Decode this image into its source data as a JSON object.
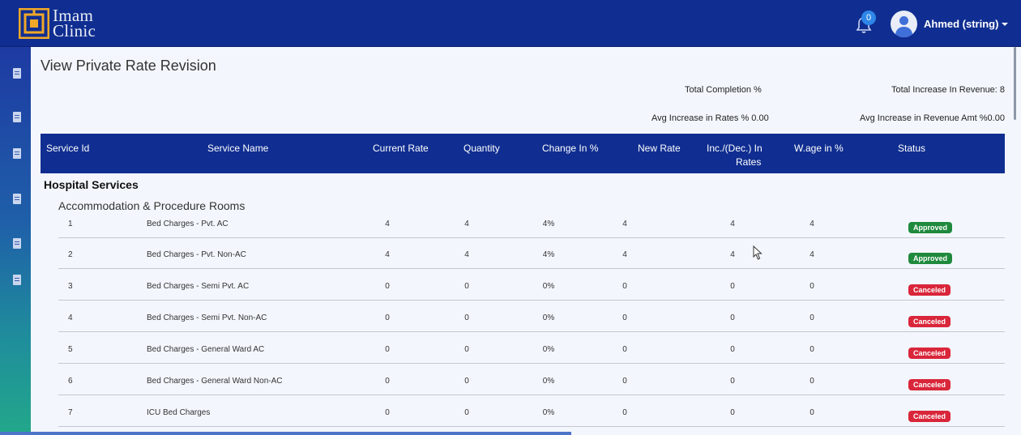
{
  "app": {
    "brand_line1": "Imam",
    "brand_line2": "Clinic"
  },
  "header": {
    "notification_count": "0",
    "user_name": "Ahmed (string)"
  },
  "page": {
    "title": "View Private Rate Revision",
    "total_completion_label": "Total Completion %",
    "total_increase_revenue_label": "Total Increase In Revenue: 8",
    "avg_increase_rates_label": "Avg Increase in Rates % 0.00",
    "avg_increase_revenue_label": "Avg Increase in Revenue Amt %0.00"
  },
  "table": {
    "headers": [
      "Service Id",
      "Service Name",
      "Current Rate",
      "Quantity",
      "Change In %",
      "New Rate",
      "Inc./(Dec.) In",
      "Rates",
      "W.age in %",
      "Status"
    ],
    "section": "Hospital Services",
    "subsection": "Accommodation & Procedure Rooms",
    "rows": [
      {
        "id": "1",
        "name": "Bed Charges - Pvt. AC",
        "current_rate": "4",
        "quantity": "4",
        "change": "4%",
        "new_rate": "4",
        "inc_dec": "4",
        "wage": "4",
        "status": "Approved"
      },
      {
        "id": "2",
        "name": "Bed Charges - Pvt. Non-AC",
        "current_rate": "4",
        "quantity": "4",
        "change": "4%",
        "new_rate": "4",
        "inc_dec": "4",
        "wage": "4",
        "status": "Approved"
      },
      {
        "id": "3",
        "name": "Bed Charges - Semi Pvt. AC",
        "current_rate": "0",
        "quantity": "0",
        "change": "0%",
        "new_rate": "0",
        "inc_dec": "0",
        "wage": "0",
        "status": "Canceled"
      },
      {
        "id": "4",
        "name": "Bed Charges - Semi Pvt. Non-AC",
        "current_rate": "0",
        "quantity": "0",
        "change": "0%",
        "new_rate": "0",
        "inc_dec": "0",
        "wage": "0",
        "status": "Canceled"
      },
      {
        "id": "5",
        "name": "Bed Charges - General Ward AC",
        "current_rate": "0",
        "quantity": "0",
        "change": "0%",
        "new_rate": "0",
        "inc_dec": "0",
        "wage": "0",
        "status": "Canceled"
      },
      {
        "id": "6",
        "name": "Bed Charges - General Ward Non-AC",
        "current_rate": "0",
        "quantity": "0",
        "change": "0%",
        "new_rate": "0",
        "inc_dec": "0",
        "wage": "0",
        "status": "Canceled"
      },
      {
        "id": "7",
        "name": "ICU Bed Charges",
        "current_rate": "0",
        "quantity": "0",
        "change": "0%",
        "new_rate": "0",
        "inc_dec": "0",
        "wage": "0",
        "status": "Canceled"
      }
    ]
  },
  "colors": {
    "primary": "#102e91",
    "approved": "#1f8a3d",
    "canceled": "#d9263a"
  },
  "icons": {
    "sidebar": "document-icon",
    "notification": "bell-icon"
  }
}
